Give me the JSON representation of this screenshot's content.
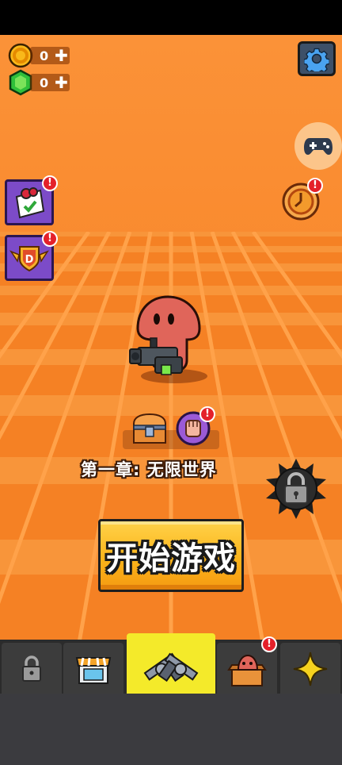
{
  "currencies": [
    {
      "name": "gold-coin-icon",
      "amount": "0",
      "plus": "✚"
    },
    {
      "name": "green-gem-icon",
      "amount": "0",
      "plus": "✚"
    }
  ],
  "badge_text": "!",
  "chapter": {
    "title": "第一章: 无限世界"
  },
  "start_button": {
    "label": "开始游戏"
  },
  "nav_tabs": [
    {
      "icon": "lock-icon",
      "active": false
    },
    {
      "icon": "shop-icon",
      "active": false
    },
    {
      "icon": "guns-icon",
      "active": true
    },
    {
      "icon": "character-box-icon",
      "active": false,
      "badge": true
    },
    {
      "icon": "star-icon",
      "active": false
    }
  ],
  "colors": {
    "background": "#f58a2a",
    "start_button": "#fbb41a",
    "active_tab": "#f4ea2a",
    "badge": "#e4202a",
    "side_button": "#7c4bc8"
  }
}
